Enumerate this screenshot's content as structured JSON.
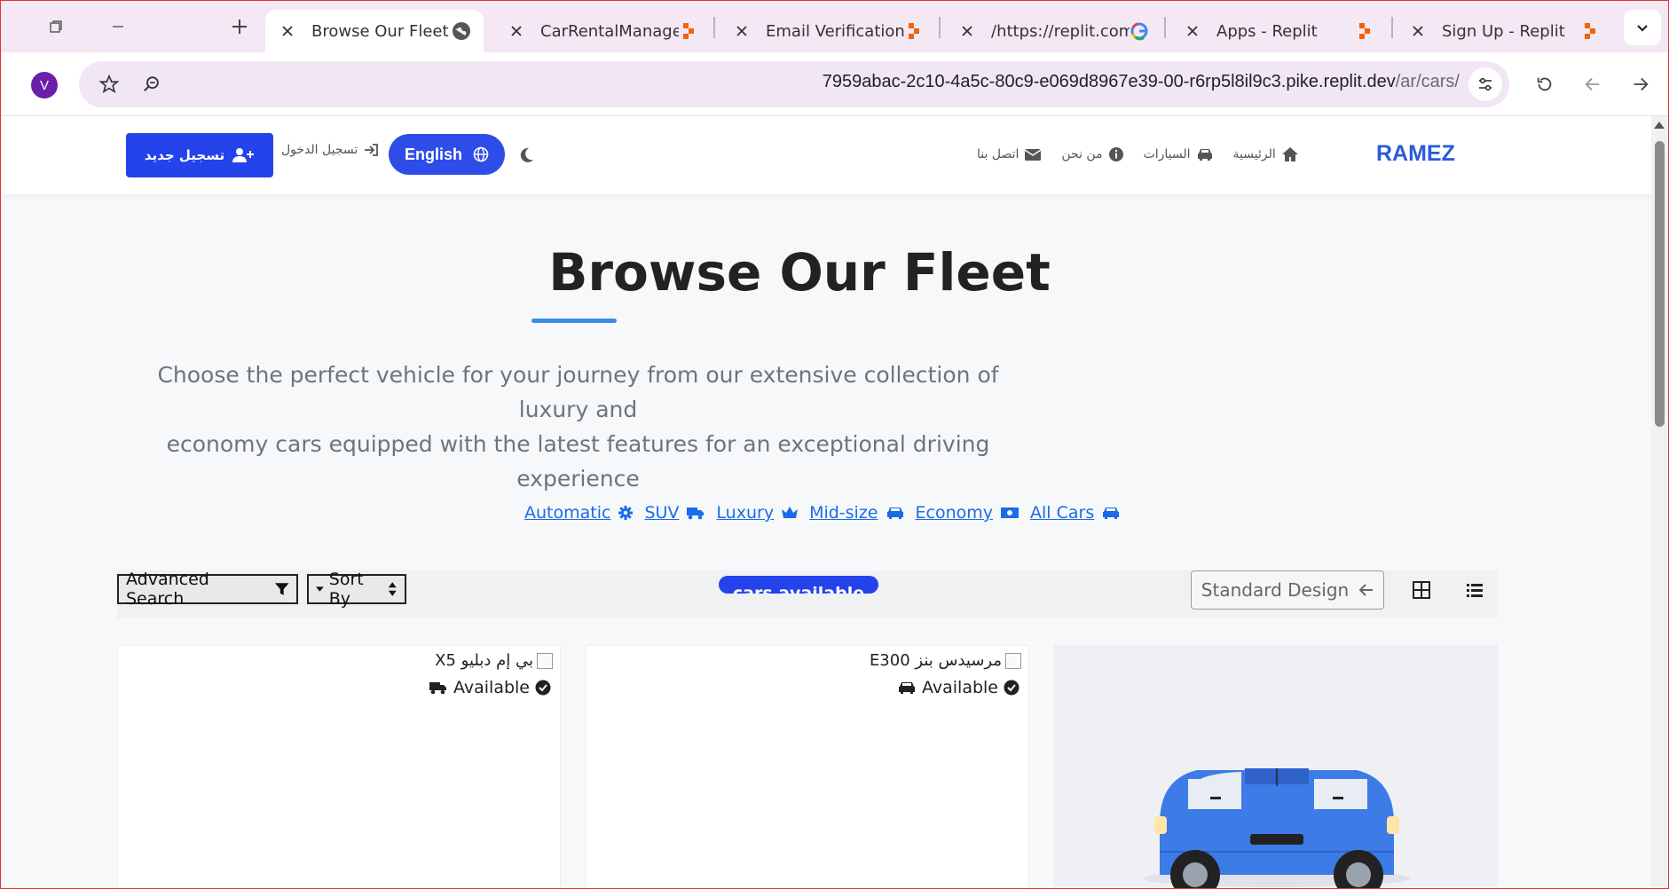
{
  "browser": {
    "tabs": [
      {
        "title": "Browse Our Fleet",
        "active": true,
        "favicon": "globe-icon"
      },
      {
        "title": "CarRentalManager",
        "active": false,
        "favicon": "replit-icon"
      },
      {
        "title": "Email Verification -",
        "active": false,
        "favicon": "replit-icon"
      },
      {
        "title": "/https://replit.com/",
        "active": false,
        "favicon": "google-icon"
      },
      {
        "title": "Apps - Replit",
        "active": false,
        "favicon": "replit-icon"
      },
      {
        "title": "Sign Up - Replit",
        "active": false,
        "favicon": "replit-icon"
      }
    ],
    "profile_initial": "V",
    "url_host": "7959abac-2c10-4a5c-80c9-e069d8967e39-00-r6rp5l8il9c3.pike.replit.dev",
    "url_path": "/ar/cars/"
  },
  "site": {
    "brand": "RAMEZ",
    "nav": [
      {
        "label": "الرئيسية",
        "icon": "home-icon"
      },
      {
        "label": "السيارات",
        "icon": "car-icon"
      },
      {
        "label": "من نحن",
        "icon": "info-icon"
      },
      {
        "label": "اتصل بنا",
        "icon": "envelope-icon"
      }
    ],
    "language_button": "English",
    "login": "تسجيل الدخول",
    "signup": "تسجيل جديد"
  },
  "hero": {
    "title": "Browse Our Fleet",
    "subtitle_line1": "Choose the perfect vehicle for your journey from our extensive collection of luxury and",
    "subtitle_line2": "economy cars equipped with the latest features for an exceptional driving experience"
  },
  "filters": [
    {
      "label": "Automatic",
      "icon": "gear-icon"
    },
    {
      "label": "SUV",
      "icon": "truck-icon"
    },
    {
      "label": "Luxury",
      "icon": "crown-icon"
    },
    {
      "label": "Mid-size",
      "icon": "car-icon"
    },
    {
      "label": "Economy",
      "icon": "money-icon"
    },
    {
      "label": "All Cars",
      "icon": "car-icon"
    }
  ],
  "controls": {
    "advanced_search": "Advanced Search",
    "sort_by": "Sort By",
    "cars_available": "cars available",
    "standard_design": "Standard Design"
  },
  "cars": [
    {
      "name": "بي إم دبليو X5",
      "status": "Available",
      "type_icon": "truck-icon"
    },
    {
      "name": "مرسيدس بنز E300",
      "status": "Available",
      "type_icon": "car-icon"
    }
  ],
  "colors": {
    "accent": "#2443ea",
    "link": "#1a6be8",
    "brand": "#2a5bd7"
  }
}
